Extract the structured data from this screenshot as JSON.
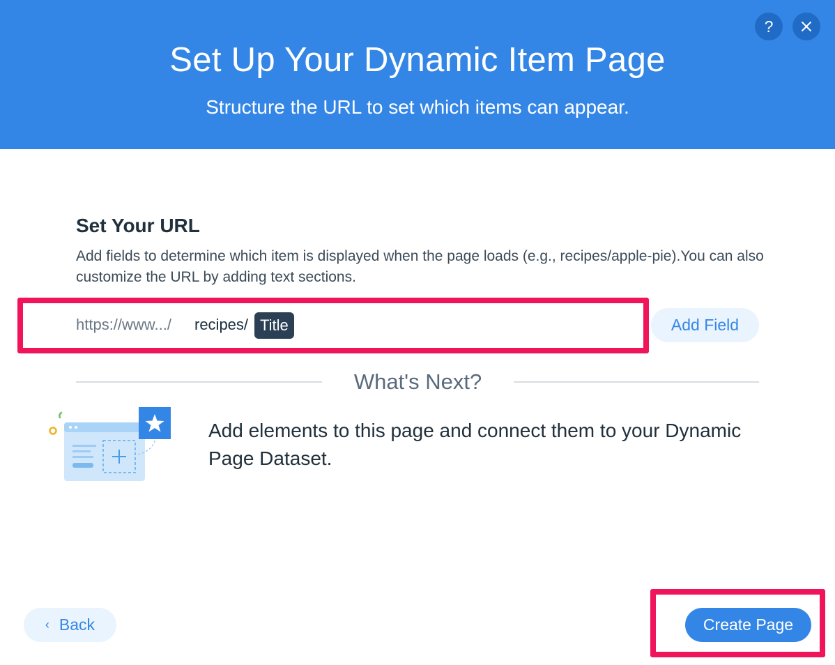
{
  "header": {
    "title": "Set Up Your Dynamic Item Page",
    "subtitle": "Structure the URL to set which items can appear.",
    "help_label": "?",
    "help_icon": "question-icon",
    "close_icon": "close-icon",
    "bg_color": "#3486e6"
  },
  "url_section": {
    "title": "Set Your URL",
    "description": "Add fields to determine which item is displayed when the page loads (e.g., recipes/apple-pie).You can also customize the URL by adding text sections.",
    "prefix": "https://www.../",
    "segment": "recipes/",
    "field_tag": "Title",
    "add_field_label": "Add Field",
    "highlight_color": "#f0145a"
  },
  "whats_next": {
    "title": "What's Next?",
    "description": "Add elements to this page and connect them to your Dynamic Page Dataset.",
    "illustration_icon": "dynamic-page-illustration-icon"
  },
  "footer": {
    "back_label": "Back",
    "back_icon": "chevron-left-icon",
    "create_label": "Create Page"
  }
}
